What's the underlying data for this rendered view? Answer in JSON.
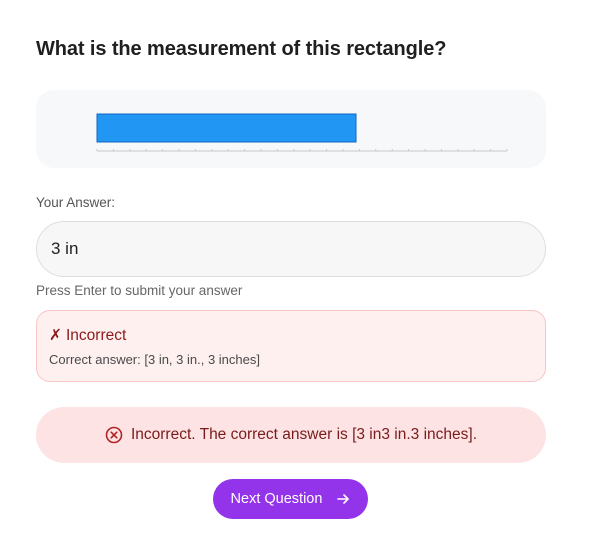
{
  "question": {
    "title": "What is the measurement of this rectangle?"
  },
  "figure": {
    "rect_color": "#2196f3",
    "rect_border_color": "#1565c0",
    "ruler_color": "#c9c9c9",
    "background_color": "#f7f8fa"
  },
  "answer": {
    "label": "Your Answer:",
    "value": "3 in",
    "hint": "Press Enter to submit your answer"
  },
  "feedback": {
    "status_icon": "✗",
    "status": "Incorrect",
    "correct_answer": "Correct answer: [3 in, 3 in., 3 inches]"
  },
  "alert": {
    "icon": "circle-x-icon",
    "message": "Incorrect. The correct answer is [3 in3 in.3 inches]."
  },
  "actions": {
    "next_label": "Next Question",
    "next_icon": "arrow-right-icon",
    "accent_color": "#9333ea"
  }
}
